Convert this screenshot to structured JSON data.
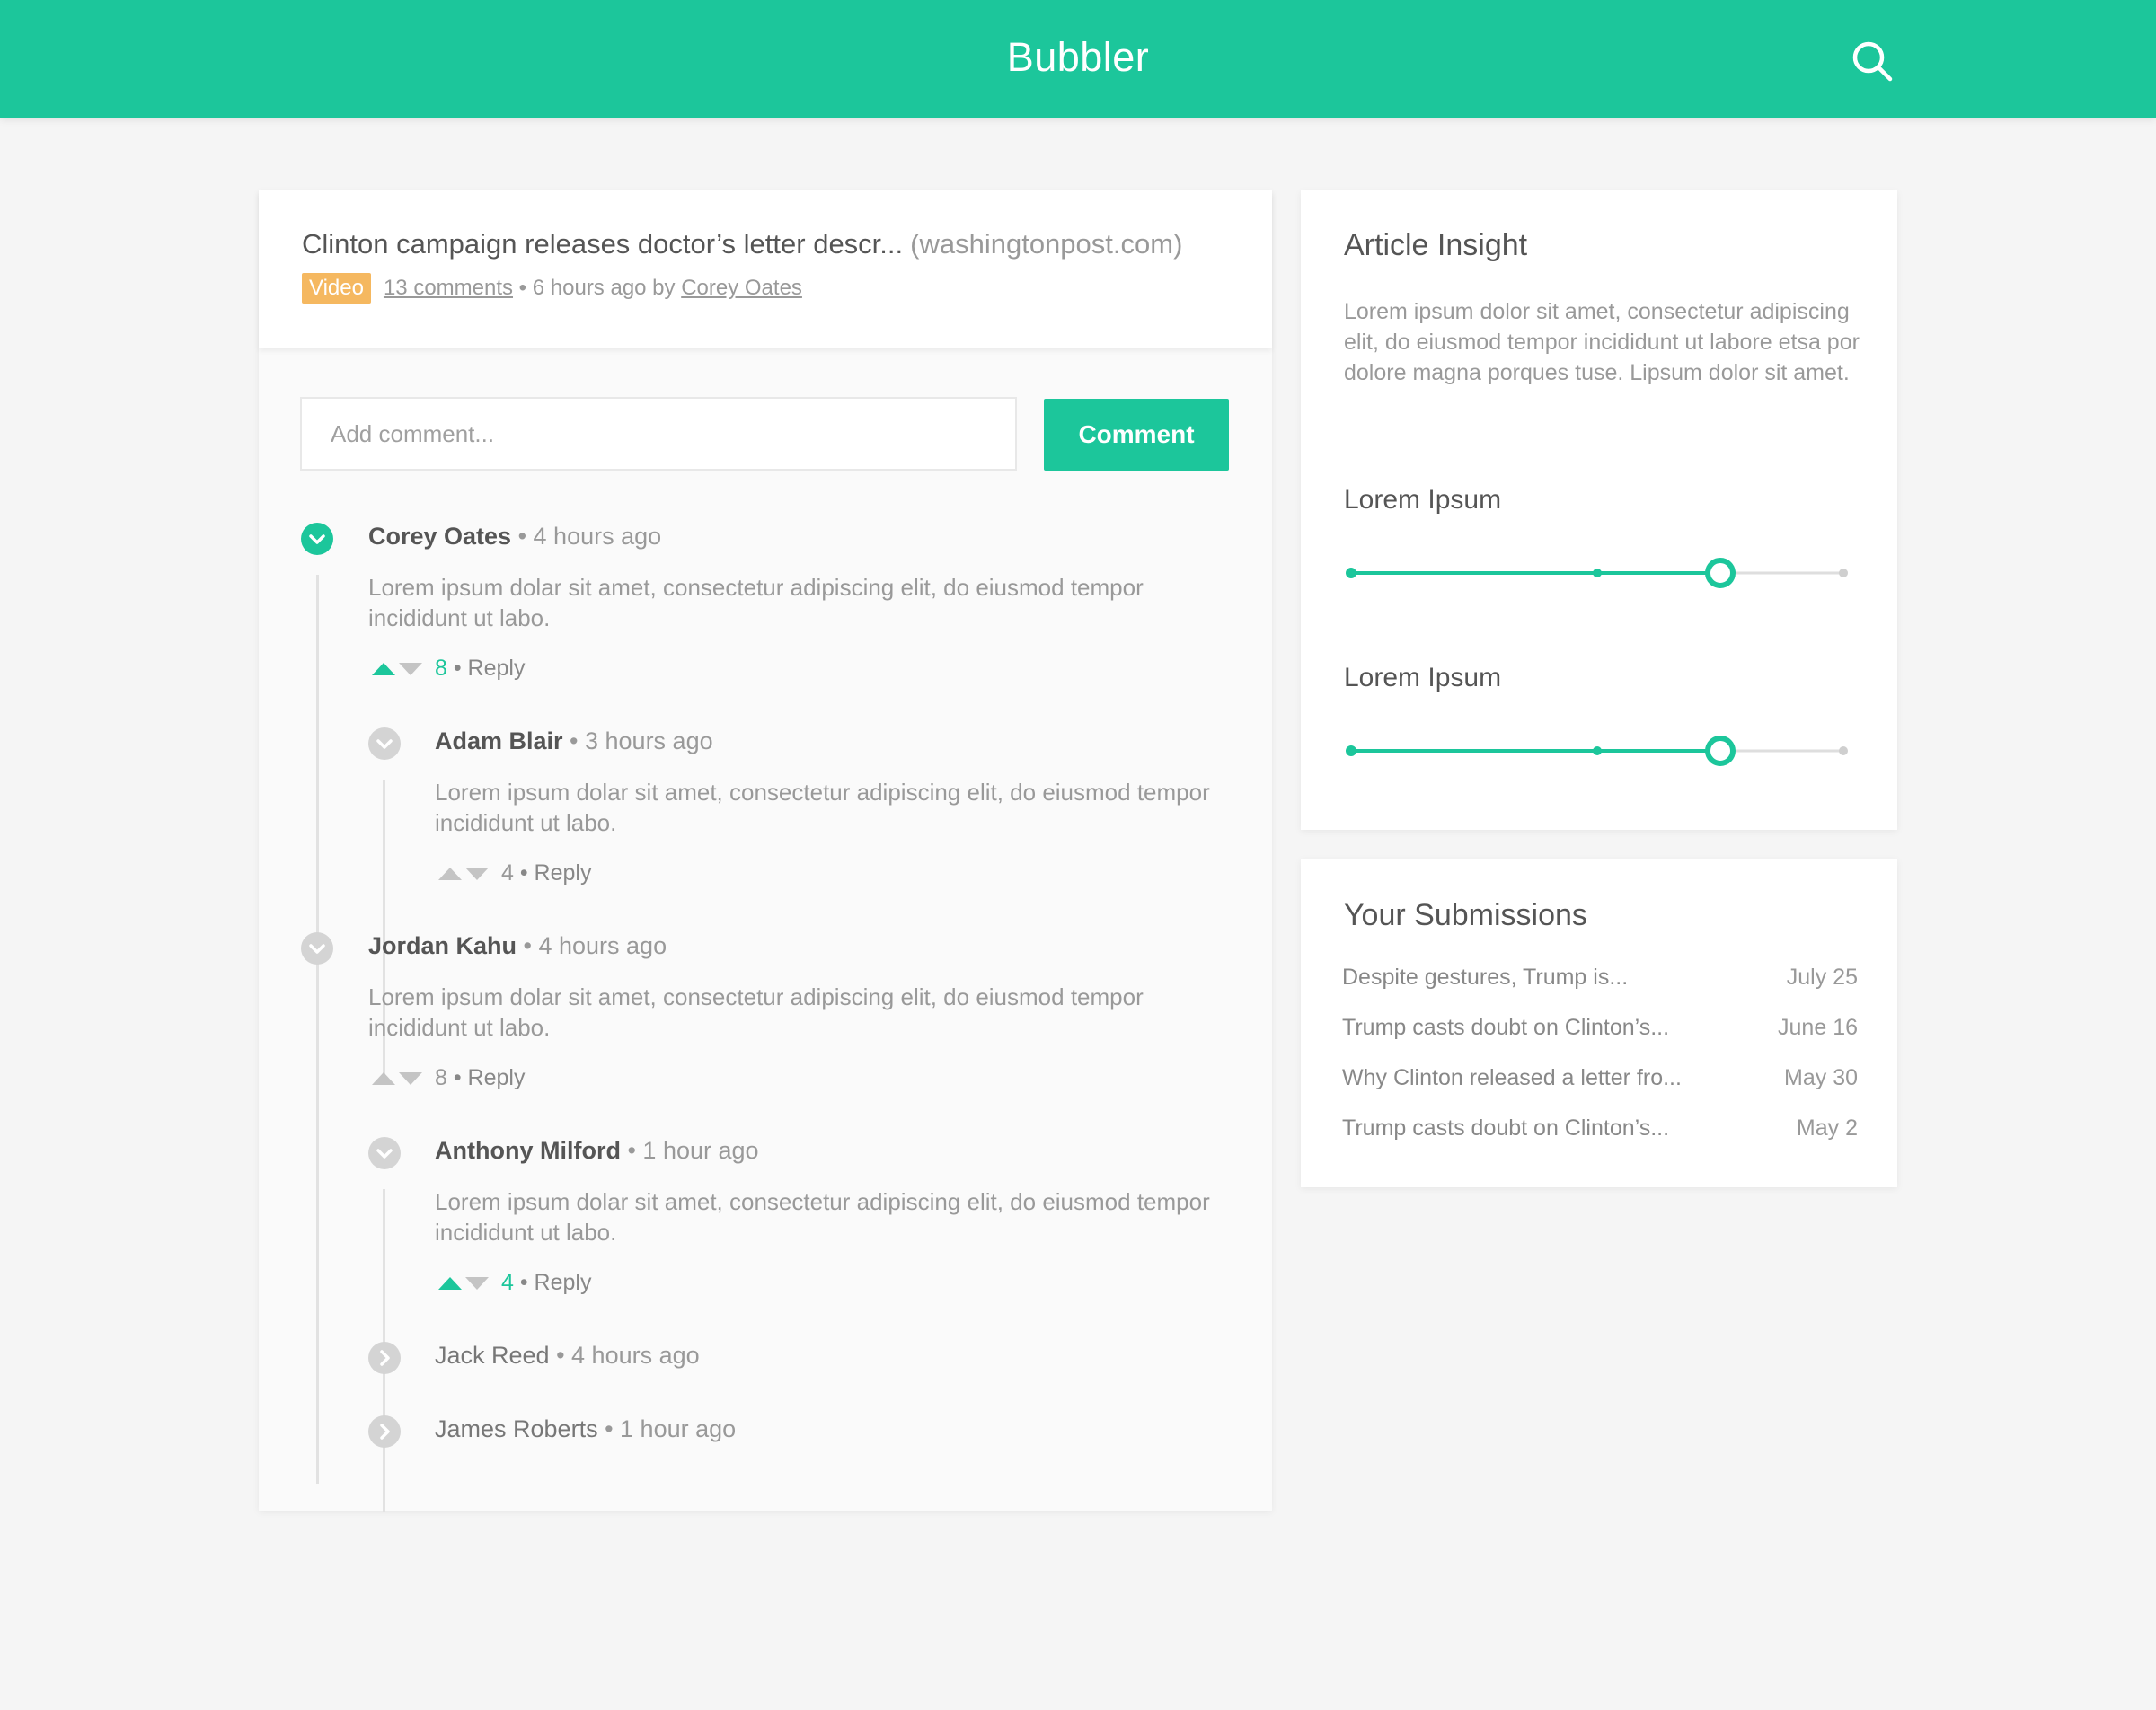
{
  "header": {
    "brand": "Bubbler"
  },
  "article": {
    "title": "Clinton campaign releases doctor’s letter descr...",
    "domain": "(washingtonpost.com)",
    "badge": "Video",
    "comments_link": "13 comments",
    "time_sep": " • 6 hours ago by ",
    "author": "Corey Oates"
  },
  "composer": {
    "placeholder": "Add comment...",
    "button": "Comment"
  },
  "comments": [
    {
      "author": "Corey Oates",
      "time": " • 4 hours ago",
      "body": "Lorem ipsum dolar sit amet, consectetur adipiscing elit, do eiusmod tempor incididunt ut labo.",
      "score": "8",
      "reply": " • Reply"
    },
    {
      "author": "Adam Blair",
      "time": " • 3 hours ago",
      "body": "Lorem ipsum dolar sit amet, consectetur adipiscing elit, do eiusmod tempor incididunt ut labo.",
      "score": "4",
      "reply": " • Reply"
    },
    {
      "author": "Jordan Kahu",
      "time": " • 4 hours ago",
      "body": "Lorem ipsum dolar sit amet, consectetur adipiscing elit, do eiusmod tempor incididunt ut labo.",
      "score": "8",
      "reply": " • Reply"
    },
    {
      "author": "Anthony Milford",
      "time": " • 1 hour ago",
      "body": "Lorem ipsum dolar sit amet, consectetur adipiscing elit, do eiusmod tempor incididunt ut labo.",
      "score": "4",
      "reply": " • Reply"
    },
    {
      "author": "Jack Reed",
      "time": " • 4 hours ago"
    },
    {
      "author": "James Roberts",
      "time": " • 1 hour ago"
    }
  ],
  "insight": {
    "title": "Article Insight",
    "text": "Lorem ipsum dolor sit amet, consectetur adipiscing elit, do eiusmod tempor incididunt ut labore etsa por dolore magna porques tuse. Lipsum dolor sit amet.",
    "sliders": [
      {
        "label": "Lorem Ipsum",
        "value": 0.75
      },
      {
        "label": "Lorem Ipsum",
        "value": 0.75
      }
    ]
  },
  "submissions": {
    "title": "Your Submissions",
    "items": [
      {
        "title": "Despite gestures, Trump is...",
        "date": "July 25"
      },
      {
        "title": "Trump casts doubt on Clinton’s...",
        "date": "June 16"
      },
      {
        "title": "Why Clinton released a letter fro...",
        "date": "May 30"
      },
      {
        "title": "Trump casts doubt on Clinton’s...",
        "date": "May 2"
      }
    ]
  },
  "colors": {
    "accent": "#1cc69b",
    "badge": "#f5b860",
    "muted": "#d4d4d4"
  }
}
